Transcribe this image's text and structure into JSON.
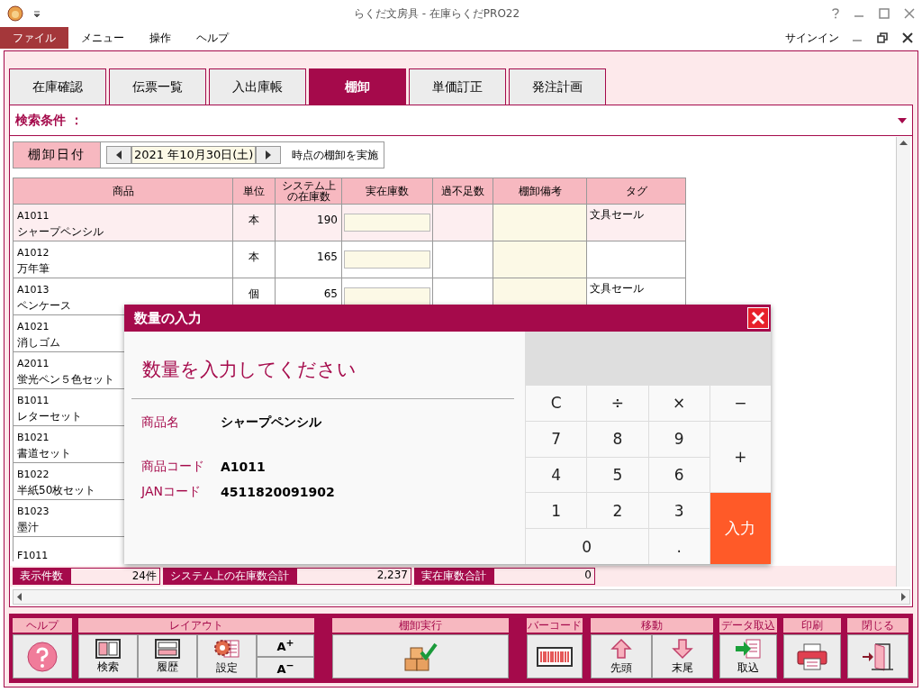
{
  "window": {
    "title": "らくだ文房具 - 在庫らくだPRO22"
  },
  "menu": {
    "items": [
      {
        "label": "ファイル",
        "selected": true
      },
      {
        "label": "メニュー",
        "selected": false
      },
      {
        "label": "操作",
        "selected": false
      },
      {
        "label": "ヘルプ",
        "selected": false
      }
    ],
    "account": "サインイン"
  },
  "tabs": [
    {
      "label": "在庫確認",
      "selected": false
    },
    {
      "label": "伝票一覧",
      "selected": false
    },
    {
      "label": "入出庫帳",
      "selected": false
    },
    {
      "label": "棚卸",
      "selected": true
    },
    {
      "label": "単価訂正",
      "selected": false
    },
    {
      "label": "発注計画",
      "selected": false
    }
  ],
  "search": {
    "label": "検索条件 ："
  },
  "date_bar": {
    "label": "棚卸日付",
    "date": "2021 年10月30日(土)",
    "suffix": "時点の棚卸を実施"
  },
  "table": {
    "columns": [
      "商品",
      "単位",
      "システム上の在庫数",
      "実在庫数",
      "過不足数",
      "棚卸備考",
      "タグ"
    ],
    "rows": [
      {
        "code": "A1011",
        "name": "シャープペンシル",
        "unit": "本",
        "system_stock": "190",
        "tag": "文具セール",
        "selected": true
      },
      {
        "code": "A1012",
        "name": "万年筆",
        "unit": "本",
        "system_stock": "165",
        "selected": false
      },
      {
        "code": "A1013",
        "name": "ペンケース",
        "unit": "個",
        "system_stock": "65",
        "tag": "文具セール",
        "selected": false
      },
      {
        "code": "A1021",
        "name": "消しゴム",
        "selected": false
      },
      {
        "code": "A2011",
        "name": "蛍光ペン５色セット",
        "selected": false
      },
      {
        "code": "B1011",
        "name": "レターセット",
        "selected": false
      },
      {
        "code": "B1021",
        "name": "書道セット",
        "selected": false
      },
      {
        "code": "B1022",
        "name": "半紙50枚セット",
        "selected": false
      },
      {
        "code": "B1023",
        "name": "墨汁",
        "selected": false
      },
      {
        "code": "F1011",
        "selected": false
      }
    ]
  },
  "summary": [
    {
      "label": "表示件数",
      "value": "24件"
    },
    {
      "label": "システム上の在庫数合計",
      "value": "2,237"
    },
    {
      "label": "実在庫数合計",
      "value": "0"
    }
  ],
  "dialog": {
    "title": "数量の入力",
    "prompt": "数量を入力してください",
    "fields": [
      {
        "label": "商品名",
        "value": "シャープペンシル"
      },
      {
        "label": "商品コード",
        "value": "A1011"
      },
      {
        "label": "JANコード",
        "value": "4511820091902"
      }
    ],
    "keys": [
      {
        "label": "C",
        "kind": "key"
      },
      {
        "label": "÷",
        "kind": "key"
      },
      {
        "label": "×",
        "kind": "key"
      },
      {
        "label": "−",
        "kind": "key"
      },
      {
        "label": "7",
        "kind": "key"
      },
      {
        "label": "8",
        "kind": "key"
      },
      {
        "label": "9",
        "kind": "key"
      },
      {
        "label": "+",
        "kind": "tall"
      },
      {
        "label": "4",
        "kind": "key"
      },
      {
        "label": "5",
        "kind": "key"
      },
      {
        "label": "6",
        "kind": "key"
      },
      {
        "label": "1",
        "kind": "key"
      },
      {
        "label": "2",
        "kind": "key"
      },
      {
        "label": "3",
        "kind": "key"
      },
      {
        "label": "入力",
        "kind": "enter"
      },
      {
        "label": "0",
        "kind": "wide"
      },
      {
        "label": ".",
        "kind": "key"
      }
    ]
  },
  "toolbar": [
    {
      "label": "ヘルプ",
      "buttons": [
        {
          "kind": "help"
        }
      ]
    },
    {
      "label": "レイアウト",
      "buttons": [
        {
          "kind": "panels",
          "label": "検索"
        },
        {
          "kind": "rows",
          "label": "履歴"
        },
        {
          "kind": "gear",
          "label": "設定"
        },
        {
          "kind": "small",
          "label": "A$^{+}$"
        },
        {
          "kind": "small",
          "label": "A$^{−}$"
        }
      ]
    },
    {
      "label": "棚卸実行",
      "buttons": [
        {
          "kind": "boxes"
        }
      ]
    },
    {
      "label": "バーコード",
      "buttons": [
        {
          "kind": "barcode"
        }
      ]
    },
    {
      "label": "移動",
      "buttons": [
        {
          "kind": "up",
          "label": "先頭"
        },
        {
          "kind": "down",
          "label": "末尾"
        }
      ]
    },
    {
      "label": "データ取込",
      "buttons": [
        {
          "kind": "import",
          "label": "取込"
        }
      ]
    },
    {
      "label": "印刷",
      "buttons": [
        {
          "kind": "printer"
        }
      ]
    },
    {
      "label": "閉じる",
      "buttons": [
        {
          "kind": "door"
        }
      ]
    }
  ]
}
